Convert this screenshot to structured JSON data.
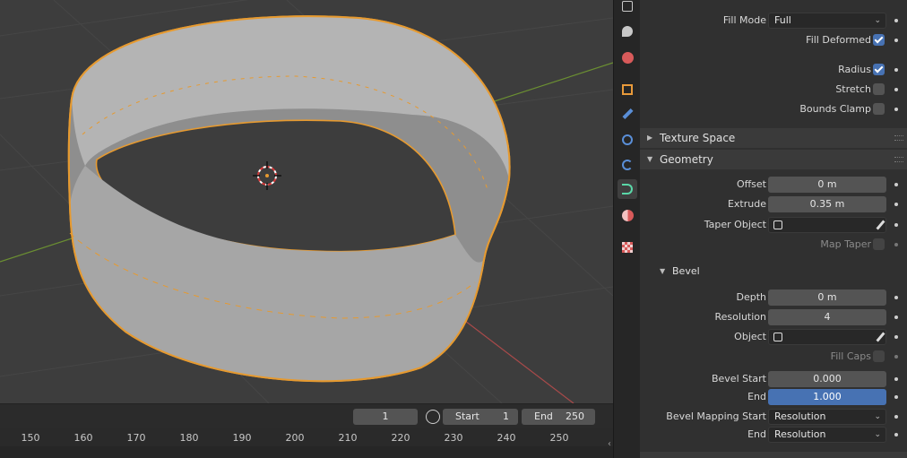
{
  "timeline": {
    "current_frame": "1",
    "start_label": "Start",
    "start_value": "1",
    "end_label": "End",
    "end_value": "250",
    "ticks": [
      "150",
      "160",
      "170",
      "180",
      "190",
      "200",
      "210",
      "220",
      "230",
      "240",
      "250"
    ]
  },
  "tabs": [
    {
      "icon": "render-icon",
      "color": "#c8c8c8"
    },
    {
      "icon": "scene-icon",
      "color": "#c8c8c8"
    },
    {
      "icon": "world-icon",
      "color": "#d85a5a"
    },
    {
      "icon": "object-icon",
      "color": "#e89a3a"
    },
    {
      "icon": "modifier-wrench-icon",
      "color": "#5a8fd8"
    },
    {
      "icon": "particles-icon",
      "color": "#5a8fd8"
    },
    {
      "icon": "physics-icon",
      "color": "#5a8fd8"
    },
    {
      "icon": "curve-data-icon",
      "color": "#5ad8a8"
    },
    {
      "icon": "material-icon",
      "color": "#d85a5a"
    },
    {
      "icon": "texture-icon",
      "color": "#d85a5a"
    }
  ],
  "props": {
    "fill_mode_label": "Fill Mode",
    "fill_mode_value": "Full",
    "fill_deformed_label": "Fill Deformed",
    "radius_label": "Radius",
    "stretch_label": "Stretch",
    "bounds_clamp_label": "Bounds Clamp",
    "texture_space_title": "Texture Space",
    "geometry_title": "Geometry",
    "offset_label": "Offset",
    "offset_value": "0 m",
    "extrude_label": "Extrude",
    "extrude_value": "0.35 m",
    "taper_object_label": "Taper Object",
    "map_taper_label": "Map Taper",
    "bevel_title": "Bevel",
    "depth_label": "Depth",
    "depth_value": "0 m",
    "resolution_label": "Resolution",
    "resolution_value": "4",
    "object_label": "Object",
    "fill_caps_label": "Fill Caps",
    "bevel_start_label": "Bevel Start",
    "bevel_start_value": "0.000",
    "end_label": "End",
    "end_value": "1.000",
    "bevel_mapping_start_label": "Bevel Mapping Start",
    "bevel_mapping_start_value": "Resolution",
    "mapping_end_label": "End",
    "mapping_end_value": "Resolution"
  }
}
